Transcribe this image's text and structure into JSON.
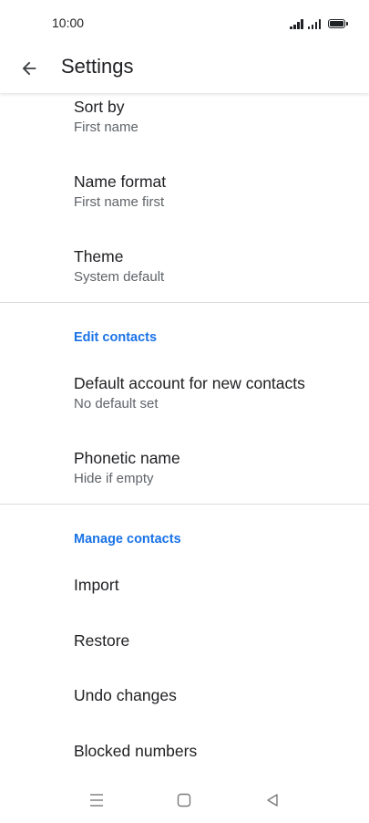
{
  "status_bar": {
    "time": "10:00"
  },
  "app_bar": {
    "title": "Settings",
    "back_icon": "arrow-left-icon"
  },
  "display_prefs": [
    {
      "title": "Sort by",
      "summary": "First name"
    },
    {
      "title": "Name format",
      "summary": "First name first"
    },
    {
      "title": "Theme",
      "summary": "System default"
    }
  ],
  "edit_contacts": {
    "header": "Edit contacts",
    "items": [
      {
        "title": "Default account for new contacts",
        "summary": "No default set"
      },
      {
        "title": "Phonetic name",
        "summary": "Hide if empty"
      }
    ]
  },
  "manage_contacts": {
    "header": "Manage contacts",
    "items": [
      {
        "title": "Import"
      },
      {
        "title": "Restore"
      },
      {
        "title": "Undo changes"
      },
      {
        "title": "Blocked numbers"
      }
    ]
  },
  "nav_bar": {
    "icons": [
      "menu-icon",
      "home-icon",
      "back-triangle-icon"
    ]
  },
  "colors": {
    "accent": "#1a73e8",
    "text_primary": "#202124",
    "text_secondary": "#5f6368",
    "divider": "#dadce0"
  }
}
